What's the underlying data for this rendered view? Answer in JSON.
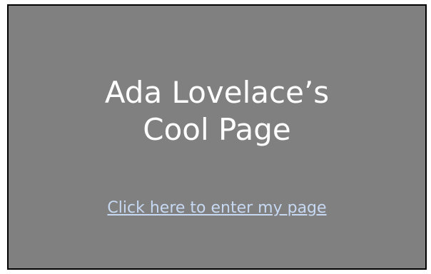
{
  "page": {
    "title_line1": "Ada Lovelace’s",
    "title_line2": "Cool Page",
    "enter_link_label": "Click here to enter my page"
  },
  "colors": {
    "panel_background": "#808080",
    "panel_border": "#000000",
    "title_text": "#ffffff",
    "link_text": "#c6d8f2"
  }
}
